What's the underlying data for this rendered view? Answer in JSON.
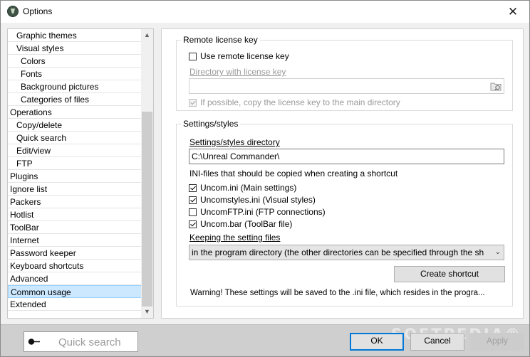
{
  "window": {
    "title": "Options",
    "close": "✕"
  },
  "tree": {
    "items": [
      {
        "label": "Graphic themes",
        "level": 1
      },
      {
        "label": "Visual styles",
        "level": 1
      },
      {
        "label": "Colors",
        "level": 2
      },
      {
        "label": "Fonts",
        "level": 2
      },
      {
        "label": "Background pictures",
        "level": 2
      },
      {
        "label": "Categories of files",
        "level": 2
      },
      {
        "label": "Operations",
        "level": 0
      },
      {
        "label": "Copy/delete",
        "level": 1
      },
      {
        "label": "Quick search",
        "level": 1
      },
      {
        "label": "Edit/view",
        "level": 1
      },
      {
        "label": "FTP",
        "level": 1
      },
      {
        "label": "Plugins",
        "level": 0
      },
      {
        "label": "Ignore list",
        "level": 0
      },
      {
        "label": "Packers",
        "level": 0
      },
      {
        "label": "Hotlist",
        "level": 0
      },
      {
        "label": "ToolBar",
        "level": 0
      },
      {
        "label": "Internet",
        "level": 0
      },
      {
        "label": "Password keeper",
        "level": 0
      },
      {
        "label": "Keyboard shortcuts",
        "level": 0
      },
      {
        "label": "Advanced",
        "level": 0
      },
      {
        "label": "Common usage",
        "level": 0,
        "selected": true
      },
      {
        "label": "Extended",
        "level": 0
      }
    ],
    "scroll_up": "▲",
    "scroll_down": "▼"
  },
  "remote": {
    "title": "Remote license key",
    "use_label": "Use remote license key",
    "use_checked": false,
    "dir_label": "Directory with license key",
    "dir_value": "",
    "copy_label": "If possible, copy the license key to the main directory",
    "copy_checked": true
  },
  "settings": {
    "title": "Settings/styles",
    "dir_label": "Settings/styles directory",
    "dir_value": "C:\\Unreal Commander\\",
    "ini_heading": "INI-files that should be copied when creating a shortcut",
    "files": [
      {
        "label": "Uncom.ini (Main settings)",
        "checked": true
      },
      {
        "label": "Uncomstyles.ini (Visual styles)",
        "checked": true
      },
      {
        "label": "UncomFTP.ini (FTP connections)",
        "checked": false
      },
      {
        "label": "Uncom.bar (ToolBar file)",
        "checked": true
      }
    ],
    "keeping_label": "Keeping the setting files",
    "keeping_value": "in the program directory (the other directories can be specified through the sh",
    "create_shortcut": "Create shortcut",
    "warning": "Warning! These settings will be saved to the .ini file, which resides in the progra..."
  },
  "bottom": {
    "quick_search_placeholder": "Quick search",
    "watermark": "SOFTPEDIA®",
    "ok": "OK",
    "cancel": "Cancel",
    "apply": "Apply"
  }
}
